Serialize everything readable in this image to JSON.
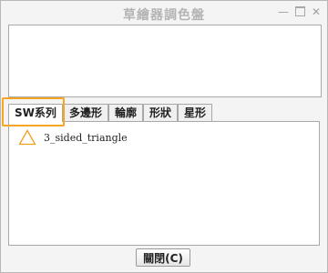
{
  "window": {
    "title": "草繪器調色盤",
    "controls": {
      "minimize_icon": "minimize-icon",
      "maximize_icon": "maximize-icon",
      "close_icon": "close-icon"
    }
  },
  "tabs": [
    {
      "label": "SW系列",
      "active": true
    },
    {
      "label": "多邊形",
      "active": false
    },
    {
      "label": "輪廓",
      "active": false
    },
    {
      "label": "形狀",
      "active": false
    },
    {
      "label": "星形",
      "active": false
    }
  ],
  "palette_items": [
    {
      "label": "3_sided_triangle",
      "icon": "triangle-icon",
      "icon_color": "#f0a020"
    }
  ],
  "footer": {
    "close_label": "關閉(C)"
  },
  "colors": {
    "highlight": "#f6a623"
  }
}
